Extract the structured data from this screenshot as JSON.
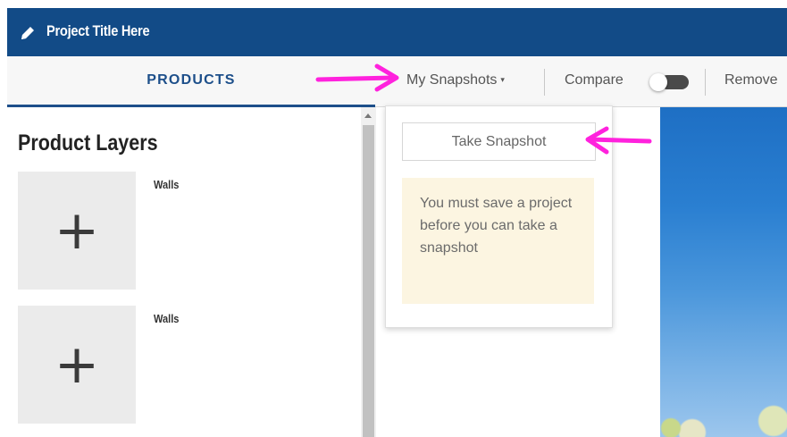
{
  "window": {
    "title": "Project Title Here",
    "title_icon": "pencil-icon",
    "bar_color": "#124b87"
  },
  "nav": {
    "products_tab": "PRODUCTS",
    "snapshots_menu": "My Snapshots",
    "snapshots_caret": "▾",
    "compare_label": "Compare",
    "compare_toggle_on": false,
    "remove_label": "Remove",
    "accent_color": "#1d4f8a"
  },
  "left_panel": {
    "heading": "Product Layers",
    "layers": [
      {
        "label": "Walls",
        "add_icon": "plus-icon",
        "add_glyph": "+"
      },
      {
        "label": "Walls",
        "add_icon": "plus-icon",
        "add_glyph": "+"
      }
    ]
  },
  "snapshot_dropdown": {
    "take_button": "Take Snapshot",
    "notice": "You must save a project before you can take a snapshot",
    "notice_bg": "#fcf5e1"
  },
  "annotations": {
    "arrow_color": "#ff22dd",
    "arrows": [
      "pointing-to-my-snapshots",
      "pointing-to-take-snapshot"
    ]
  }
}
